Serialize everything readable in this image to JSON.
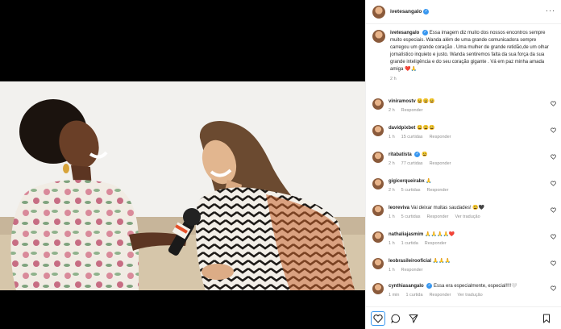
{
  "post": {
    "author": "ivetesangalo",
    "caption_author": "ivetesangalo",
    "caption_text": "Essa imagem diz muito dos nossos encontros sempre muito especiais. Wanda além de uma grande comunicadora sempre carregou um grande coração . Uma mulher de grande retidão,de um olhar jornalístico inquieto e justo. Wanda sentiremos falta da sua força da sua grande inteligência e do seu coração gigante . Vá em paz minha amada amiga ❤️🙏",
    "caption_time": "2 h"
  },
  "comments": [
    {
      "user": "viniramostv",
      "text": "😩😩😩",
      "time": "2 h",
      "likes": "",
      "reply": "Responder",
      "translate": ""
    },
    {
      "user": "davidpixbet",
      "text": "😩😩😩",
      "time": "1 h",
      "likes": "15 curtidas",
      "reply": "Responder",
      "translate": ""
    },
    {
      "user": "ritabatista",
      "text": "😩",
      "time": "2 h",
      "likes": "77 curtidas",
      "reply": "Responder",
      "translate": ""
    },
    {
      "user": "gigicerqueirabx",
      "text": "🙏",
      "time": "2 h",
      "likes": "5 curtidas",
      "reply": "Responder",
      "translate": ""
    },
    {
      "user": "leoreviva",
      "text": "Vai deixar muitas saudades! 😩🖤",
      "time": "1 h",
      "likes": "5 curtidas",
      "reply": "Responder",
      "translate": "Ver tradução"
    },
    {
      "user": "nathaliajasmim",
      "text": "🙏🙏🙏🙏❤️",
      "time": "1 h",
      "likes": "1 curtida",
      "reply": "Responder",
      "translate": ""
    },
    {
      "user": "leobrasileirooficial",
      "text": "🙏🙏🙏",
      "time": "1 h",
      "likes": "",
      "reply": "Responder",
      "translate": ""
    },
    {
      "user": "cynthiasangalo",
      "text": "Essa era especialmente, especial!!!!🤍",
      "time": "1 min",
      "likes": "1 curtida",
      "reply": "Responder",
      "translate": "Ver tradução"
    }
  ],
  "media": {
    "mic_flag_text": "GNT"
  },
  "colors": {
    "accent": "#3897f0",
    "text": "#262626",
    "muted": "#8e8e8e",
    "like": "#ed4956"
  }
}
